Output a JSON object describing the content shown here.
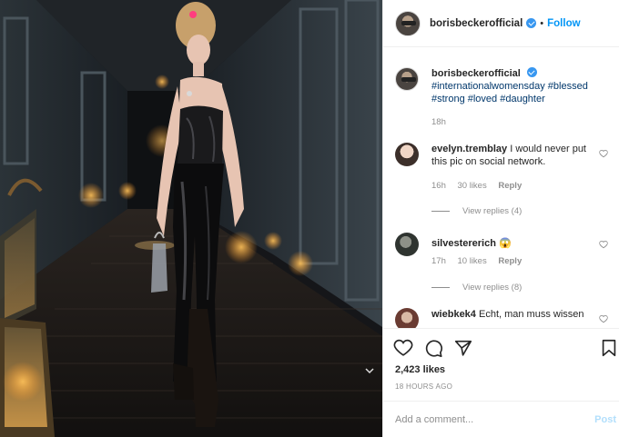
{
  "post": {
    "username": "borisbeckerofficial",
    "follow_label": "Follow",
    "separator": "•"
  },
  "caption": {
    "username": "borisbeckerofficial",
    "hashtags": "#internationalwomensday #blessed #strong #loved #daughter",
    "time": "18h"
  },
  "comments": [
    {
      "username": "evelyn.tremblay",
      "text": "I would never put this pic on social network.",
      "time": "16h",
      "likes": "30 likes",
      "reply_label": "Reply",
      "view_replies": "View replies (4)"
    },
    {
      "username": "silvestererich",
      "text": "😱",
      "time": "17h",
      "likes": "10 likes",
      "reply_label": "Reply",
      "view_replies": "View replies (8)"
    },
    {
      "username": "wiebkek4",
      "text": "Echt, man muss wissen"
    }
  ],
  "footer": {
    "likes": "2,423 likes",
    "time_ago": "18 HOURS AGO",
    "comment_placeholder": "Add a comment...",
    "post_label": "Post"
  },
  "icons": {
    "like": "heart-icon",
    "comment": "comment-icon",
    "share": "share-icon",
    "save": "bookmark-icon",
    "verified": "verified-badge-icon"
  },
  "colors": {
    "link": "#0095f6",
    "hashtag": "#00376b",
    "muted": "#8e8e8e",
    "verified": "#3897f0",
    "post_disabled": "#b2dffc"
  }
}
